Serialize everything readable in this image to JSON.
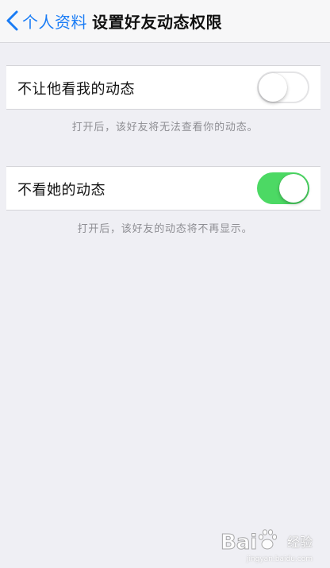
{
  "nav": {
    "back_label": "个人资料",
    "title": "设置好友动态权限"
  },
  "settings": [
    {
      "label": "不让他看我的动态",
      "enabled": false,
      "footnote": "打开后，该好友将无法查看你的动态。"
    },
    {
      "label": "不看她的动态",
      "enabled": true,
      "footnote": "打开后，该好友的动态将不再显示。"
    }
  ],
  "colors": {
    "accent": "#1a7cf5",
    "toggle_on": "#4cd964",
    "background": "#efeff4"
  },
  "watermark": {
    "brand": "Bai",
    "suffix": "经验",
    "url": "jingyan.baidu.com"
  }
}
